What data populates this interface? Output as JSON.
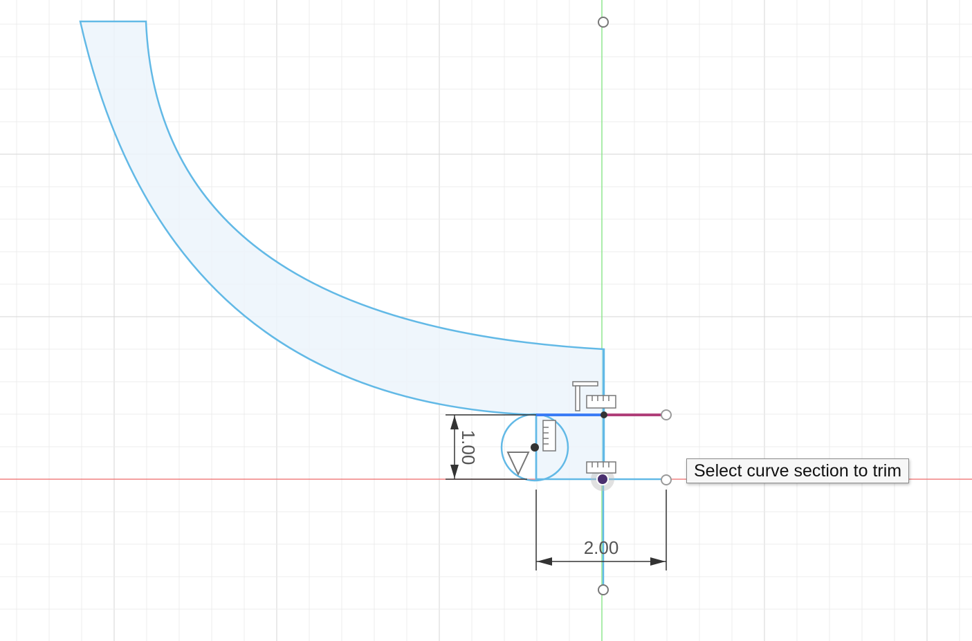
{
  "tooltip": {
    "text": "Select curve section to trim"
  },
  "dimensions": {
    "vertical": "1.00",
    "horizontal": "2.00"
  },
  "colors": {
    "grid_minor": "#ececec",
    "grid_major": "#d6d6d6",
    "x_axis": "#f08080",
    "y_axis": "#8ee68e",
    "profile_stroke": "#62b9e6",
    "profile_fill": "#ecf5fc",
    "selected_line": "#3b7cf5",
    "constrained_line": "#b0407a",
    "dimension_line": "#333333"
  },
  "icons": [
    "horizontal-constraint-icon",
    "vertical-constraint-icon",
    "tangent-constraint-icon",
    "coincident-constraint-icon",
    "ruler-icon"
  ]
}
